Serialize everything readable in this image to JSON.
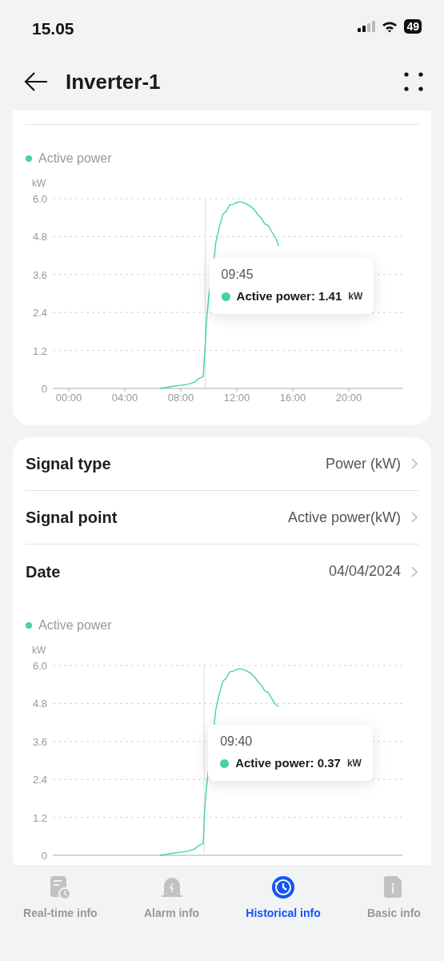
{
  "status_bar": {
    "time": "15.05",
    "battery": "49"
  },
  "header": {
    "title": "Inverter-1"
  },
  "charts": [
    {
      "tooltip": {
        "time": "09:45",
        "text": "Active power: 1.41",
        "unit": "kW"
      },
      "chart_data": {
        "type": "line",
        "ylabel": "kW",
        "grid": true,
        "xlim": [
          -1.14,
          23.83
        ],
        "ylim": [
          0,
          6
        ],
        "yticks": [
          0,
          1.2,
          2.4,
          3.6,
          4.8,
          {
            "value": 6,
            "label": "6.0"
          }
        ],
        "xticks": [
          {
            "value": 0,
            "label": "00:00"
          },
          {
            "value": 4,
            "label": "04:00"
          },
          {
            "value": 8,
            "label": "08:00"
          },
          {
            "value": 12,
            "label": "12:00"
          },
          {
            "value": 16,
            "label": "16:00"
          },
          {
            "value": 20,
            "label": "20:00"
          }
        ],
        "ref_lines": [
          {
            "axis": "x",
            "value": 9.75
          }
        ],
        "x": [
          6.5,
          7.0,
          7.5,
          8.0,
          8.5,
          9.0,
          9.25,
          9.6,
          9.75,
          9.85,
          10.0,
          10.4,
          10.5,
          10.75,
          11.0,
          11.25,
          11.5,
          11.75,
          12.0,
          12.25,
          12.5,
          12.75,
          13.0,
          13.25,
          13.5,
          13.75,
          14.0,
          14.25,
          14.5,
          14.75,
          15.0
        ],
        "series": [
          {
            "name": "Active power",
            "color": "#45d3a0",
            "values": [
              0,
              0.03,
              0.07,
              0.1,
              0.13,
              0.2,
              0.3,
              0.38,
              1.41,
              2.2,
              2.9,
              4.2,
              4.6,
              5.1,
              5.5,
              5.6,
              5.8,
              5.82,
              5.88,
              5.9,
              5.87,
              5.82,
              5.75,
              5.65,
              5.5,
              5.38,
              5.2,
              5.15,
              4.95,
              4.78,
              4.5
            ]
          }
        ]
      }
    },
    {
      "tooltip": {
        "time": "09:40",
        "text": "Active power: 0.37",
        "unit": "kW"
      },
      "chart_data": {
        "type": "line",
        "ylabel": "kW",
        "grid": true,
        "xlim": [
          -1.14,
          23.83
        ],
        "ylim": [
          0,
          6
        ],
        "yticks": [
          0,
          1.2,
          2.4,
          3.6,
          4.8,
          {
            "value": 6,
            "label": "6.0"
          }
        ],
        "ref_lines": [
          {
            "axis": "x",
            "value": 9.67
          }
        ],
        "x": [
          6.5,
          7.0,
          7.5,
          8.0,
          8.5,
          9.0,
          9.25,
          9.6,
          9.7,
          9.85,
          10.4,
          10.5,
          10.75,
          11.0,
          11.25,
          11.5,
          11.75,
          12.0,
          12.25,
          12.5,
          12.75,
          13.0,
          13.25,
          13.5,
          13.75,
          14.0,
          14.25,
          14.5,
          14.75,
          15.0
        ],
        "series": [
          {
            "name": "Active power",
            "color": "#45d3a0",
            "values": [
              0,
              0.03,
              0.07,
              0.1,
              0.13,
              0.2,
              0.3,
              0.37,
              1.41,
              2.2,
              4.2,
              4.6,
              5.1,
              5.5,
              5.6,
              5.8,
              5.82,
              5.88,
              5.9,
              5.87,
              5.82,
              5.75,
              5.65,
              5.5,
              5.38,
              5.2,
              5.15,
              4.95,
              4.78,
              4.7
            ]
          }
        ]
      }
    }
  ],
  "settings": [
    {
      "label": "Signal type",
      "value": "Power (kW)"
    },
    {
      "label": "Signal point",
      "value": "Active power(kW)"
    },
    {
      "label": "Date",
      "value": "04/04/2024"
    }
  ],
  "tabs": [
    {
      "label": "Real-time info",
      "selected": false
    },
    {
      "label": "Alarm info",
      "selected": false
    },
    {
      "label": "Historical info",
      "selected": true
    },
    {
      "label": "Basic info",
      "selected": false
    }
  ]
}
